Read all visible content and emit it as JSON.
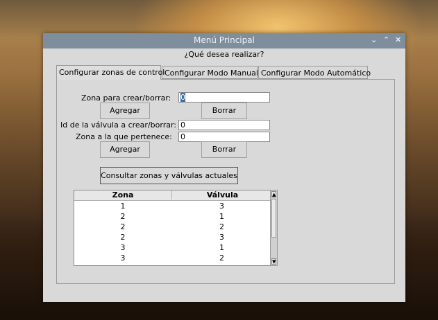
{
  "window": {
    "title": "Menú Principal",
    "controls": [
      "⌄",
      "⌃",
      "✕"
    ]
  },
  "question": "¿Qué desea realizar?",
  "tabs": [
    {
      "label": "Configurar zonas de control",
      "active": true
    },
    {
      "label": "Configurar Modo Manual",
      "active": false
    },
    {
      "label": "Configurar Modo Automático",
      "active": false
    }
  ],
  "zones_form": {
    "zone_label": "Zona para crear/borrar:",
    "zone_value": "0",
    "add_label": "Agregar",
    "delete_label": "Borrar"
  },
  "valves_form": {
    "valve_label": "Id de la válvula a crear/borrar:",
    "valve_value": "0",
    "zone_label": "Zona a la que pertenece:",
    "zone_value": "0",
    "add_label": "Agregar",
    "delete_label": "Borrar"
  },
  "query_button": "Consultar zonas y válvulas actuales",
  "table": {
    "headers": [
      "Zona",
      "Válvula"
    ],
    "rows": [
      [
        "1",
        "3"
      ],
      [
        "2",
        "1"
      ],
      [
        "2",
        "2"
      ],
      [
        "2",
        "3"
      ],
      [
        "3",
        "1"
      ],
      [
        "3",
        "2"
      ]
    ]
  },
  "icons": {
    "scroll_up": "▲",
    "scroll_down": "▼"
  }
}
